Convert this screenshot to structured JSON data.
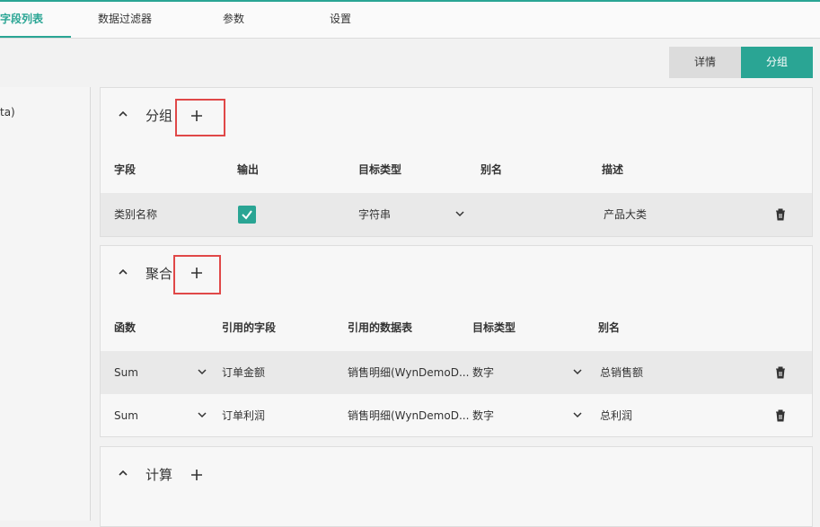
{
  "tabs": [
    {
      "label": "字段列表",
      "active": true
    },
    {
      "label": "数据过滤器",
      "active": false
    },
    {
      "label": "参数",
      "active": false
    },
    {
      "label": "设置",
      "active": false
    }
  ],
  "buttons": {
    "detail": "详情",
    "group": "分组"
  },
  "left_panel": {
    "item": "ta)"
  },
  "group_section": {
    "title": "分组",
    "headers": [
      "字段",
      "输出",
      "目标类型",
      "别名",
      "描述"
    ],
    "rows": [
      {
        "field": "类别名称",
        "output_checked": true,
        "type": "字符串",
        "alias": "",
        "desc": "产品大类"
      }
    ]
  },
  "agg_section": {
    "title": "聚合",
    "headers": [
      "函数",
      "引用的字段",
      "引用的数据表",
      "目标类型",
      "别名"
    ],
    "rows": [
      {
        "func": "Sum",
        "field": "订单金额",
        "table": "销售明细(WynDemoD...",
        "type": "数字",
        "alias": "总销售额"
      },
      {
        "func": "Sum",
        "field": "订单利润",
        "table": "销售明细(WynDemoD...",
        "type": "数字",
        "alias": "总利润"
      }
    ]
  },
  "calc_section": {
    "title": "计算"
  },
  "colors": {
    "accent": "#2aa594",
    "highlight": "#e04848"
  },
  "icons": [
    "chevron-up-icon",
    "plus-icon",
    "chevron-down-icon",
    "trash-icon",
    "check-icon"
  ]
}
